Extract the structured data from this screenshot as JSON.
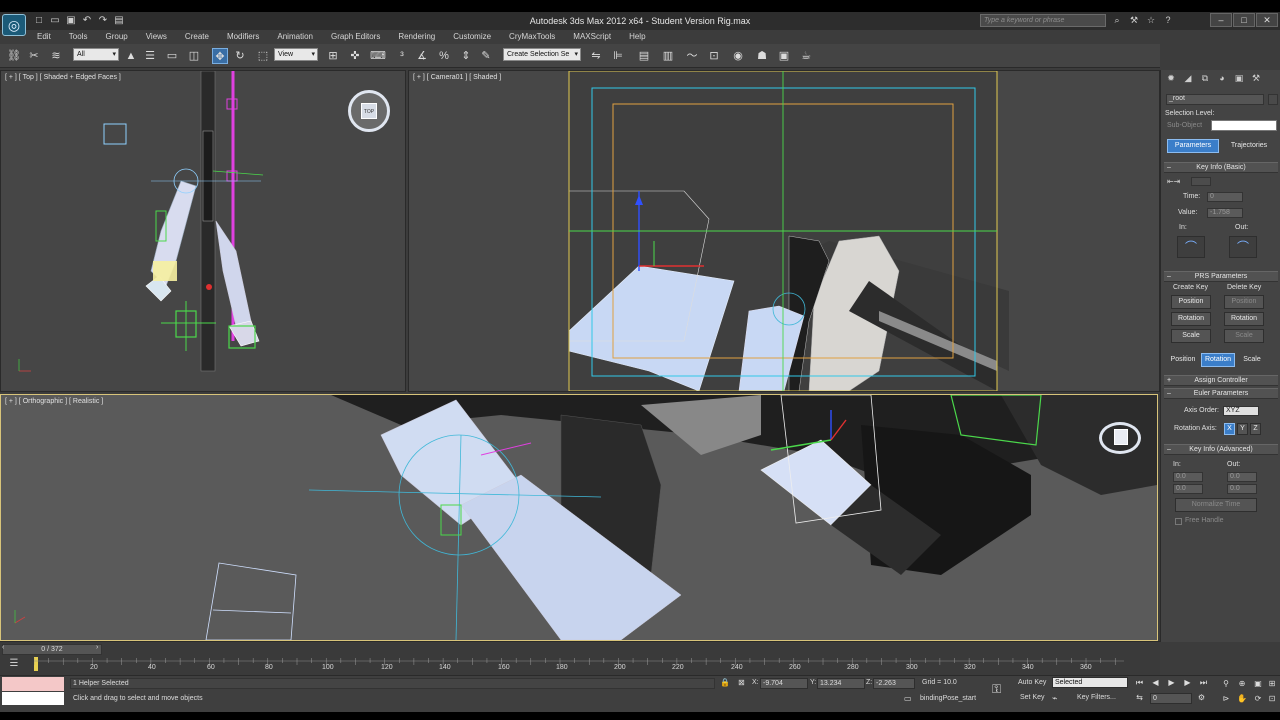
{
  "window": {
    "title": "Autodesk 3ds Max  2012 x64   -  Student Version    Rig.max",
    "search_placeholder": "Type a keyword or phrase",
    "controls": [
      "–",
      "□",
      "✕"
    ]
  },
  "quick_access": [
    "□",
    "▭",
    "▣",
    "↶",
    "↷",
    "▤"
  ],
  "help_icons": [
    "⌕",
    "⚒",
    "☆",
    "?"
  ],
  "menu": [
    "Edit",
    "Tools",
    "Group",
    "Views",
    "Create",
    "Modifiers",
    "Animation",
    "Graph Editors",
    "Rendering",
    "Customize",
    "CryMaxTools",
    "MAXScript",
    "Help"
  ],
  "toolbar": {
    "selection_filter": "All",
    "ref_coord": "View",
    "named_selection": "Create Selection Se"
  },
  "viewports": {
    "top": {
      "label": "[ + ] [ Top ] [ Shaded + Edged Faces ]",
      "viewcube": "TOP"
    },
    "camera": {
      "label": "[ + ] [ Camera01 ] [ Shaded ]"
    },
    "ortho": {
      "label": "[ + ] [ Orthographic ] [ Realistic ]"
    }
  },
  "command_panel": {
    "object_name": "_root",
    "selection_level": "Selection Level:",
    "sub_object": "Sub-Object",
    "tabs": {
      "parameters": "Parameters",
      "trajectories": "Trajectories"
    },
    "key_info_basic": {
      "title": "Key Info (Basic)",
      "time_label": "Time:",
      "time_value": "0",
      "value_label": "Value:",
      "value_value": "-1.758",
      "in_label": "In:",
      "out_label": "Out:"
    },
    "prs": {
      "title": "PRS Parameters",
      "create_key": "Create Key",
      "delete_key": "Delete Key",
      "position": "Position",
      "rotation": "Rotation",
      "scale": "Scale"
    },
    "assign_controller": "Assign Controller",
    "euler": {
      "title": "Euler Parameters",
      "axis_order_label": "Axis Order:",
      "axis_order_value": "XYZ",
      "rotation_axis_label": "Rotation Axis:",
      "x": "X",
      "y": "Y",
      "z": "Z"
    },
    "key_info_adv": {
      "title": "Key Info (Advanced)",
      "in_label": "In:",
      "out_label": "Out:",
      "in_v1": "0.0",
      "in_v2": "0.0",
      "out_v1": "0.0",
      "out_v2": "0.0",
      "normalize": "Normalize Time",
      "free_handle": "Free Handle"
    }
  },
  "timeline": {
    "slider_label": "0 / 372",
    "ticks": [
      "20",
      "40",
      "60",
      "80",
      "100",
      "120",
      "140",
      "160",
      "180",
      "200",
      "220",
      "240",
      "260",
      "280",
      "300",
      "320",
      "340",
      "360"
    ]
  },
  "status": {
    "selected": "1 Helper Selected",
    "prompt": "Click and drag to select and move objects",
    "x_label": "X:",
    "x_value": "-9.704",
    "y_label": "Y:",
    "y_value": "13.234",
    "z_label": "Z:",
    "z_value": "-2.263",
    "grid": "Grid = 10.0",
    "selection_set": "bindingPose_start",
    "auto_key": "Auto Key",
    "selected_dd": "Selected",
    "set_key": "Set Key",
    "key_filters": "Key Filters...",
    "frame": "0"
  }
}
